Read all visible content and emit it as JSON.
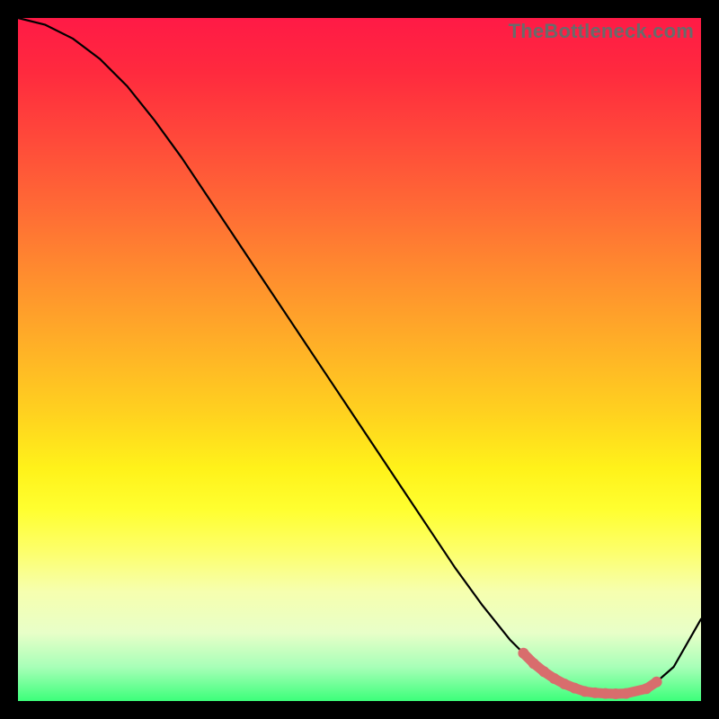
{
  "watermark": "TheBottleneck.com",
  "colors": {
    "top": "#ff1a46",
    "mid": "#fff21a",
    "bottom": "#3cff7a",
    "curve": "#000000",
    "marker": "#d86d6d",
    "page_bg": "#000000"
  },
  "chart_data": {
    "type": "line",
    "title": "",
    "xlabel": "",
    "ylabel": "",
    "xlim": [
      0,
      100
    ],
    "ylim": [
      0,
      100
    ],
    "grid": false,
    "series": [
      {
        "name": "curve",
        "x": [
          0,
          4,
          8,
          12,
          16,
          20,
          24,
          28,
          32,
          36,
          40,
          44,
          48,
          52,
          56,
          60,
          64,
          68,
          72,
          76,
          80,
          84,
          88,
          92,
          96,
          100
        ],
        "y": [
          100,
          99,
          97,
          94,
          90,
          85,
          79.5,
          73.5,
          67.5,
          61.5,
          55.5,
          49.5,
          43.5,
          37.5,
          31.5,
          25.5,
          19.5,
          14,
          9,
          5,
          2.5,
          1.2,
          1,
          1.5,
          5,
          12
        ]
      },
      {
        "name": "markers",
        "x": [
          74,
          75.5,
          77,
          78.5,
          80,
          81.5,
          83,
          84.5,
          86,
          87.5,
          89,
          92,
          93.5
        ],
        "y": [
          7,
          5.5,
          4.3,
          3.3,
          2.5,
          1.9,
          1.4,
          1.2,
          1.1,
          1.05,
          1.1,
          1.8,
          2.8
        ]
      }
    ],
    "gradient_stops": [
      {
        "pos": 0,
        "color": "#ff1a46"
      },
      {
        "pos": 0.5,
        "color": "#fff21a"
      },
      {
        "pos": 1,
        "color": "#3cff7a"
      }
    ]
  }
}
